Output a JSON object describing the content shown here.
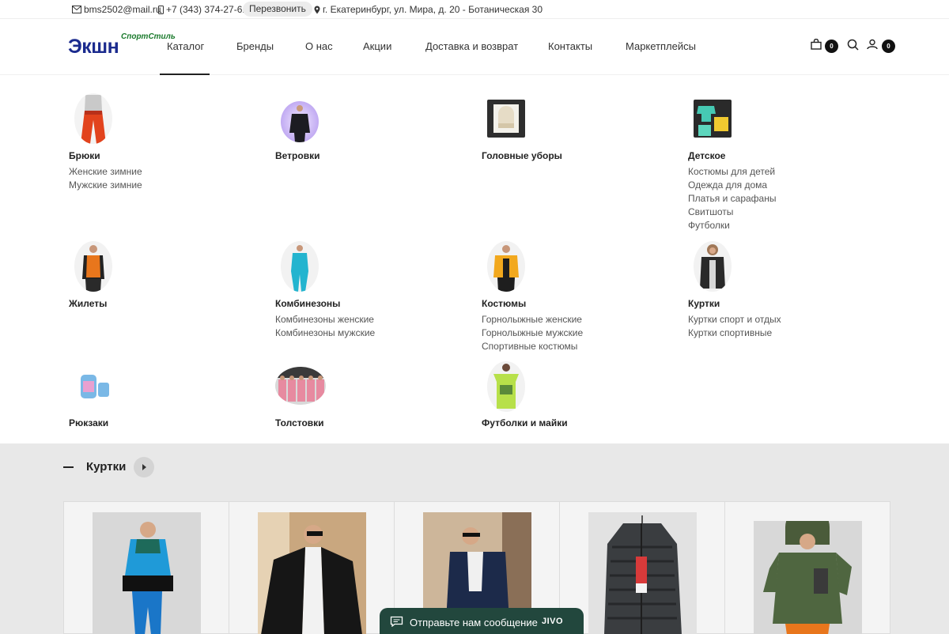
{
  "topbar": {
    "email": "bms2502@mail.ru",
    "phone": "+7 (343) 374-27-61",
    "callback_label": "Перезвонить",
    "address": "г. Екатеринбург, ул. Мира, д. 20 - Ботаническая 30"
  },
  "header": {
    "logo_main": "Экшн",
    "logo_sub": "СпортСтиль",
    "nav": [
      "Каталог",
      "Бренды",
      "О нас",
      "Акции",
      "Доставка и возврат",
      "Контакты",
      "Маркетплейсы"
    ],
    "cart_count": "0",
    "account_count": "0",
    "icons": [
      "cart-icon",
      "search-icon",
      "user-icon"
    ]
  },
  "catalog": [
    {
      "title": "Брюки",
      "subs": [
        "Женские зимние",
        "Мужские зимние"
      ]
    },
    {
      "title": "Ветровки",
      "subs": []
    },
    {
      "title": "Головные уборы",
      "subs": []
    },
    {
      "title": "Детское",
      "subs": [
        "Костюмы для детей",
        "Одежда для дома",
        "Платья и сарафаны",
        "Свитшоты",
        "Футболки"
      ]
    },
    {
      "title": "Жилеты",
      "subs": []
    },
    {
      "title": "Комбинезоны",
      "subs": [
        "Комбинезоны женские",
        "Комбинезоны мужские"
      ]
    },
    {
      "title": "Костюмы",
      "subs": [
        "Горнолыжные женские",
        "Горнолыжные мужские",
        "Спортивные костюмы"
      ]
    },
    {
      "title": "Куртки",
      "subs": [
        "Куртки спорт и отдых",
        "Куртки спортивные"
      ]
    },
    {
      "title": "Рюкзаки",
      "subs": []
    },
    {
      "title": "Толстовки",
      "subs": []
    },
    {
      "title": "Футболки и майки",
      "subs": []
    }
  ],
  "section": {
    "title": "Куртки"
  },
  "chat": {
    "label": "Отправьте нам сообщение",
    "brand": "JIVO"
  }
}
